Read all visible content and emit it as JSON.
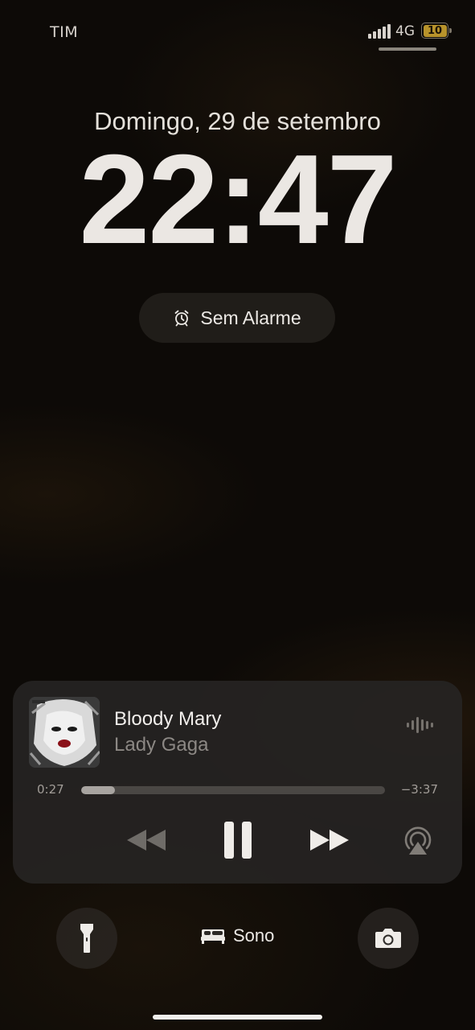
{
  "status_bar": {
    "carrier": "TIM",
    "network": "4G",
    "battery_percent": "10",
    "battery_color": "#b8932b",
    "signal_icon": "signal-bars-icon"
  },
  "lock_screen": {
    "date": "Domingo, 29 de setembro",
    "time": "22:47",
    "alarm_label": "Sem Alarme",
    "alarm_icon": "alarm-clock-icon"
  },
  "now_playing": {
    "title": "Bloody Mary",
    "artist": "Lady Gaga",
    "elapsed": "0:27",
    "remaining": "−3:37",
    "progress": 0.11,
    "controls": [
      "rewind-icon",
      "pause-icon",
      "fast-forward-icon",
      "airplay-icon"
    ]
  },
  "shortcuts": {
    "left_icon": "flashlight-icon",
    "center_label": "Sono",
    "center_icon": "bed-icon",
    "right_icon": "camera-icon"
  }
}
